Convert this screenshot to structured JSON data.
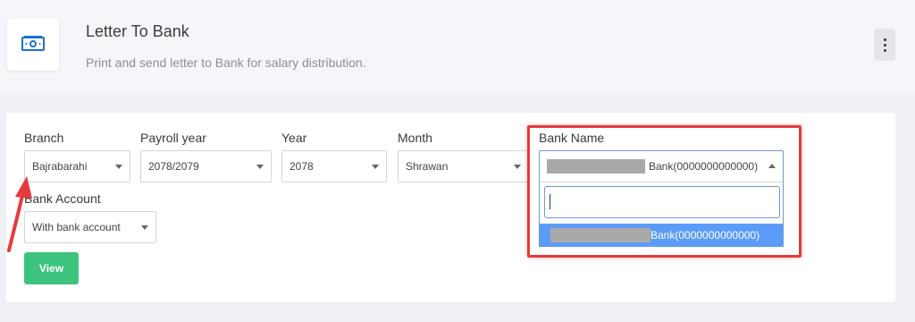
{
  "header": {
    "title": "Letter To Bank",
    "subtitle": "Print and send letter to Bank for salary distribution.",
    "icon": "money-icon",
    "menu_icon": "kebab-icon"
  },
  "filters": {
    "branch": {
      "label": "Branch",
      "value": "Bajrabarahi"
    },
    "payroll_year": {
      "label": "Payroll year",
      "value": "2078/2079"
    },
    "year": {
      "label": "Year",
      "value": "2078"
    },
    "month": {
      "label": "Month",
      "value": "Shrawan"
    },
    "bank_name": {
      "label": "Bank Name",
      "selected_suffix": "Bank(0000000000000)",
      "search_value": "",
      "options": [
        {
          "suffix": "Bank(0000000000000)"
        }
      ]
    },
    "bank_account": {
      "label": "Bank Account",
      "value": "With bank account"
    }
  },
  "actions": {
    "view_label": "View"
  },
  "colors": {
    "accent_green": "#3cc47c",
    "highlight_red": "#e53b3b",
    "option_blue": "#5b9cf8",
    "icon_blue": "#1e6fd1"
  }
}
